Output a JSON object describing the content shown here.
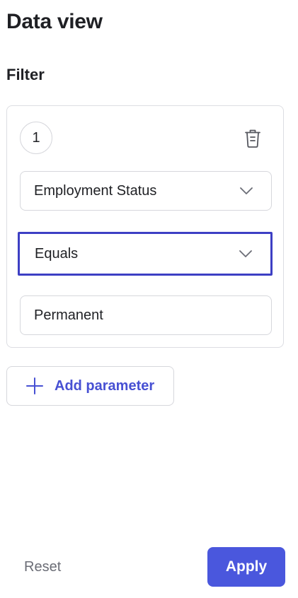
{
  "header": {
    "title": "Data view"
  },
  "filter": {
    "section_label": "Filter",
    "index": "1",
    "delete_icon": "trash-icon",
    "field_name": {
      "value": "Employment Status",
      "icon": "chevron-down-icon"
    },
    "operator": {
      "value": "Equals",
      "icon": "chevron-down-icon",
      "focused": true
    },
    "value_input": {
      "value": "Permanent"
    }
  },
  "add_parameter": {
    "label": "Add parameter",
    "icon": "plus-icon"
  },
  "footer": {
    "reset_label": "Reset",
    "apply_label": "Apply"
  },
  "colors": {
    "accent": "#4a57dd",
    "accent_text": "#4750d3",
    "focus_ring": "#3d3fc4",
    "border": "#d6d7dc",
    "muted_text": "#6b6d76"
  }
}
